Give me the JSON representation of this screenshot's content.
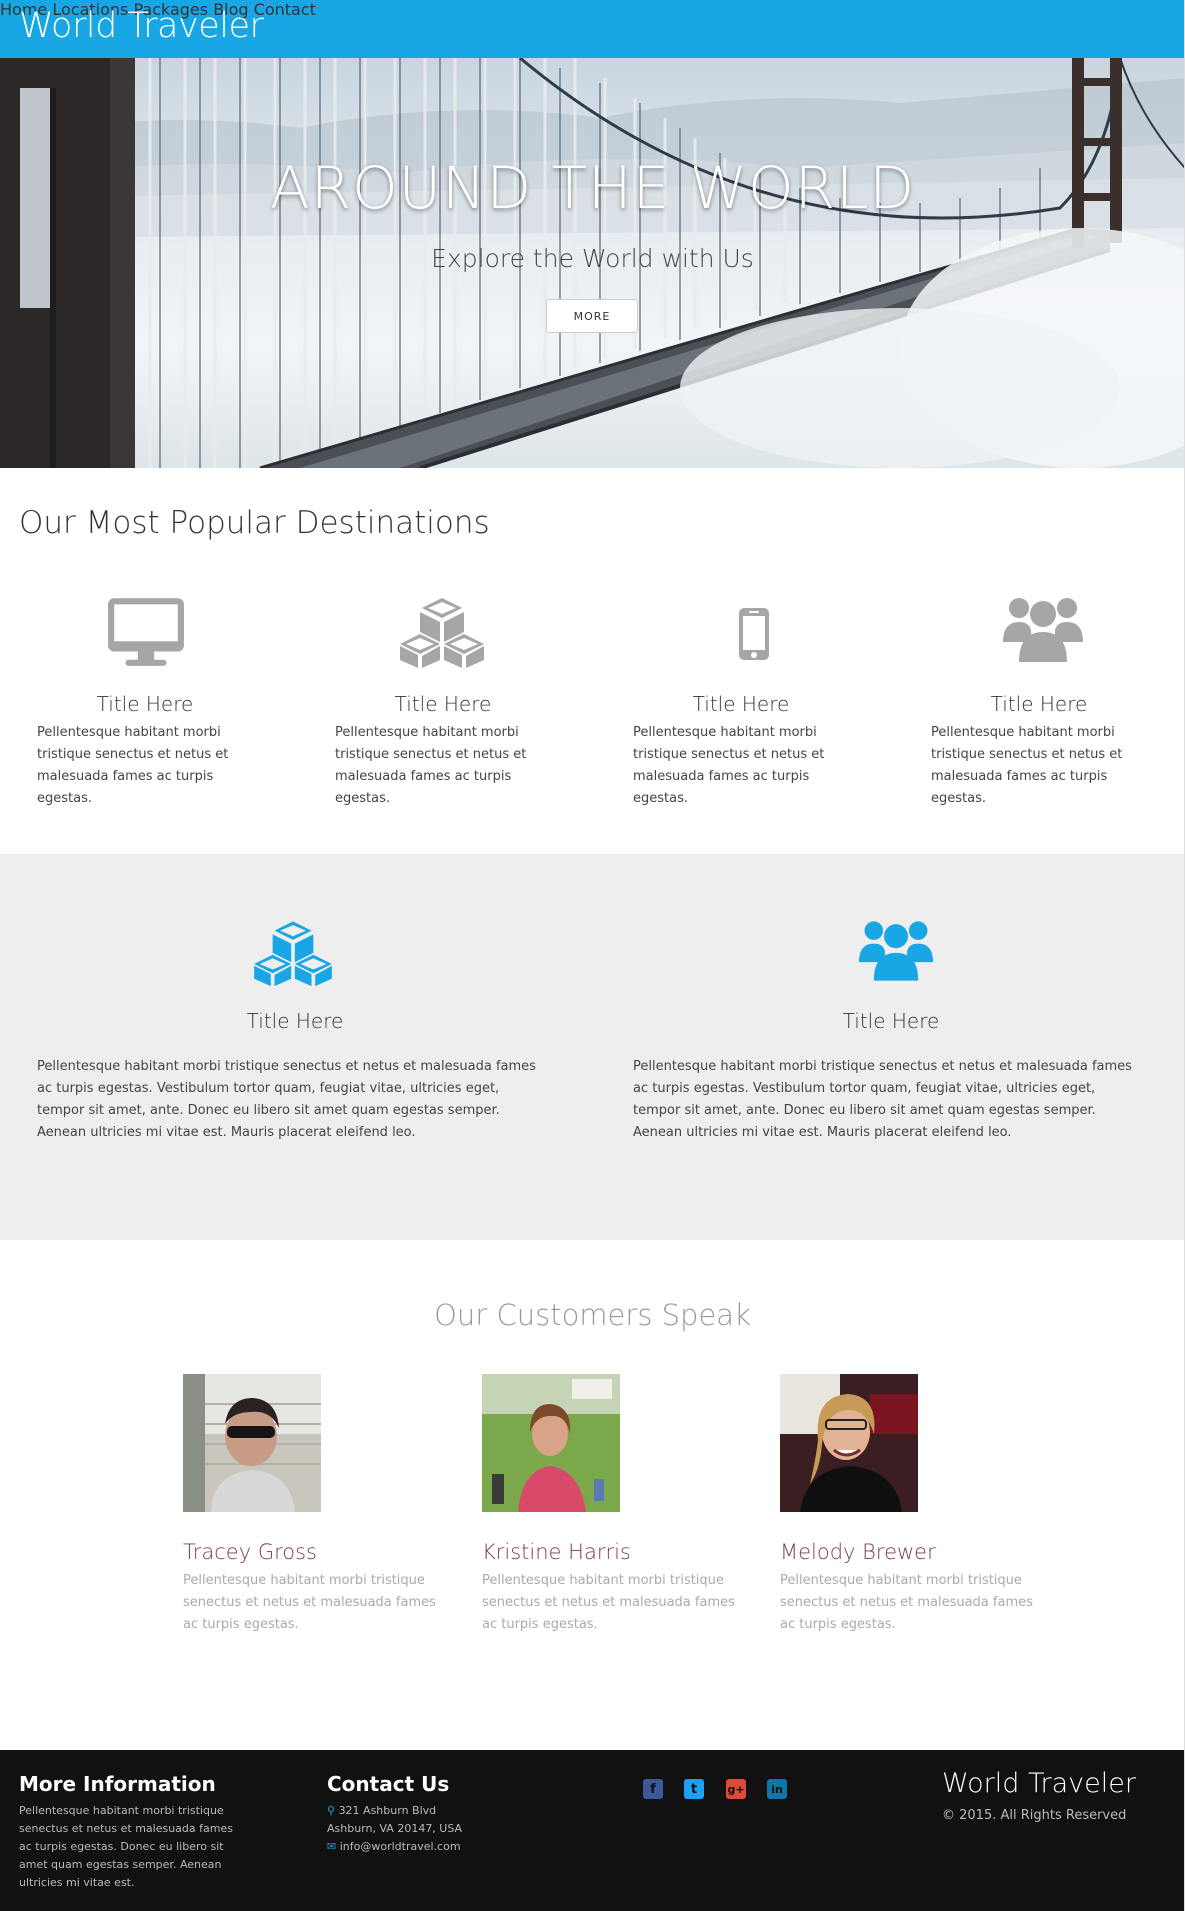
{
  "nav": {
    "brand": "World Traveler",
    "items": [
      {
        "label": "Home"
      },
      {
        "label": "Locations"
      },
      {
        "label": "Packages"
      },
      {
        "label": "Blog"
      },
      {
        "label": "Contact"
      }
    ]
  },
  "hero": {
    "title": "AROUND THE WORLD",
    "subtitle": "Explore the World with Us",
    "button_label": "MORE"
  },
  "popular": {
    "heading": "Our Most Popular Destinations",
    "features": [
      {
        "icon": "desktop-icon",
        "title": "Title Here",
        "text": "Pellentesque habitant morbi tristique senectus et netus et malesuada fames ac turpis egestas."
      },
      {
        "icon": "cubes-icon",
        "title": "Title Here",
        "text": "Pellentesque habitant morbi tristique senectus et netus et malesuada fames ac turpis egestas."
      },
      {
        "icon": "mobile-icon",
        "title": "Title Here",
        "text": "Pellentesque habitant morbi tristique senectus et netus et malesuada fames ac turpis egestas."
      },
      {
        "icon": "users-icon",
        "title": "Title Here",
        "text": "Pellentesque habitant morbi tristique senectus et netus et malesuada fames ac turpis egestas."
      }
    ]
  },
  "highlights": [
    {
      "icon": "cubes-icon",
      "title": "Title Here",
      "text": "Pellentesque habitant morbi tristique senectus et netus et malesuada fames ac turpis egestas. Vestibulum tortor quam, feugiat vitae, ultricies eget, tempor sit amet, ante. Donec eu libero sit amet quam egestas semper. Aenean ultricies mi vitae est. Mauris placerat eleifend leo."
    },
    {
      "icon": "users-icon",
      "title": "Title Here",
      "text": "Pellentesque habitant morbi tristique senectus et netus et malesuada fames ac turpis egestas. Vestibulum tortor quam, feugiat vitae, ultricies eget, tempor sit amet, ante. Donec eu libero sit amet quam egestas semper. Aenean ultricies mi vitae est. Mauris placerat eleifend leo."
    }
  ],
  "customers": {
    "heading": "Our Customers Speak",
    "items": [
      {
        "name": "Tracey Gross",
        "text": "Pellentesque habitant morbi tristique senectus et netus et malesuada fames ac turpis egestas."
      },
      {
        "name": "Kristine Harris",
        "text": "Pellentesque habitant morbi tristique senectus et netus et malesuada fames ac turpis egestas."
      },
      {
        "name": "Melody Brewer",
        "text": "Pellentesque habitant morbi tristique senectus et netus et malesuada fames ac turpis egestas."
      }
    ]
  },
  "footer": {
    "more_heading": "More Information",
    "more_text": "Pellentesque habitant morbi tristique senectus et netus et malesuada fames ac turpis egestas. Donec eu libero sit amet quam egestas semper. Aenean ultricies mi vitae est.",
    "contact_heading": "Contact Us",
    "address_line1": "321 Ashburn Blvd",
    "address_line2": "Ashburn, VA 20147, USA",
    "email": "info@worldtravel.com",
    "social": [
      {
        "icon": "facebook-icon",
        "glyph": "f",
        "color": "#3b5998"
      },
      {
        "icon": "twitter-icon",
        "glyph": "t",
        "color": "#1da1f2"
      },
      {
        "icon": "google-plus-icon",
        "glyph": "g+",
        "color": "#dd4b39"
      },
      {
        "icon": "linkedin-icon",
        "glyph": "in",
        "color": "#0e76a8"
      }
    ],
    "brand": "World Traveler",
    "copyright": "© 2015. All Rights Reserved"
  },
  "colors": {
    "accent": "#19a6e4",
    "icon_grey": "#a6a6a6",
    "customer_name": "#7a3a5f",
    "footer_bg": "#111111"
  }
}
